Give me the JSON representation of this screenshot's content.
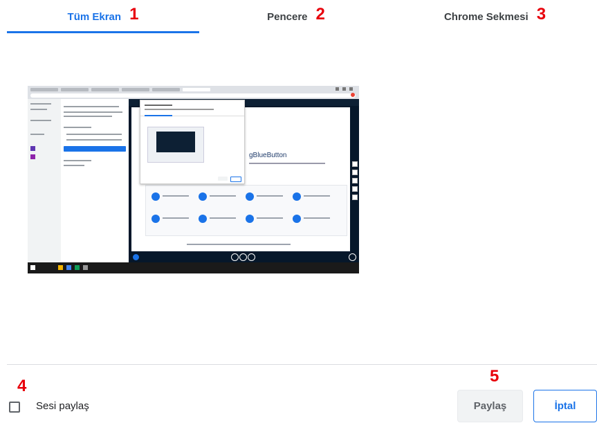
{
  "tabs": [
    {
      "label": "Tüm Ekran",
      "marker": "1",
      "active": true
    },
    {
      "label": "Pencere",
      "marker": "2",
      "active": false
    },
    {
      "label": "Chrome Sekmesi",
      "marker": "3",
      "active": false
    }
  ],
  "preview": {
    "icon": "screen-thumbnail",
    "app_title_fragment": "gBlueButton"
  },
  "share_audio": {
    "marker": "4",
    "label": "Sesi paylaş",
    "checked": false
  },
  "actions": {
    "marker": "5",
    "share_label": "Paylaş",
    "cancel_label": "İptal"
  },
  "colors": {
    "accent": "#1a73e8",
    "marker_red": "#e8000b",
    "divider": "#dadce0"
  }
}
